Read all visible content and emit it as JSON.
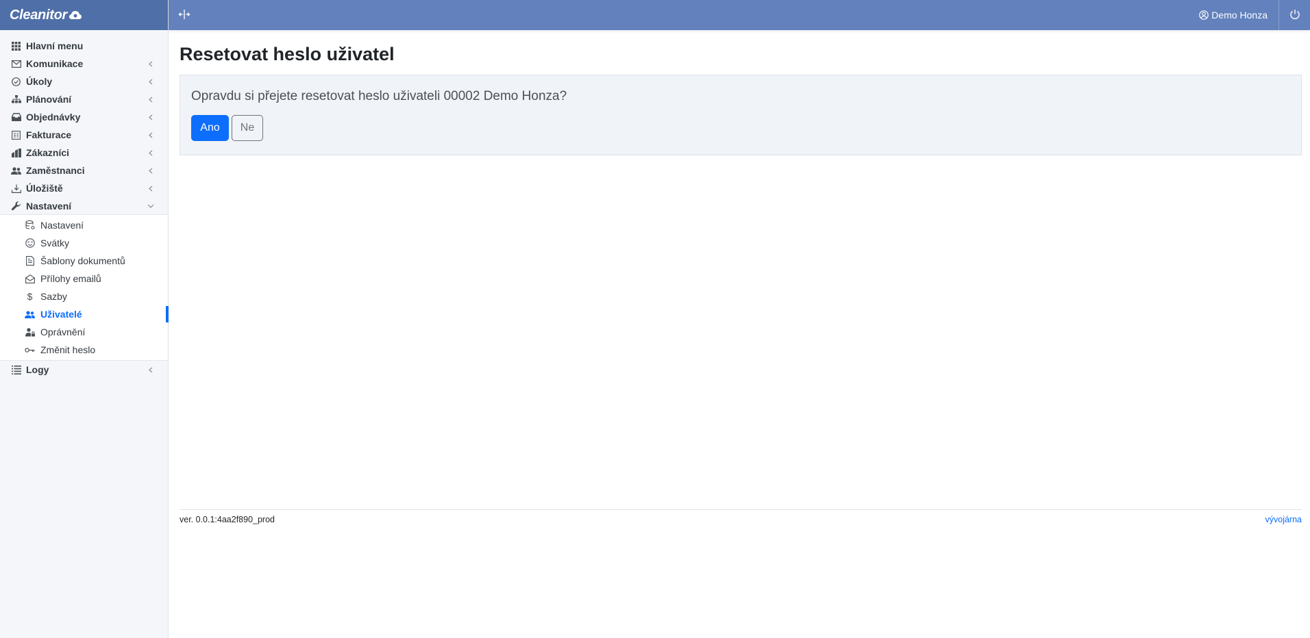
{
  "brand": {
    "name": "Cleanitor"
  },
  "header": {
    "user_name": "Demo Honza"
  },
  "sidebar": {
    "items": [
      {
        "label": "Hlavní menu",
        "icon": "grid-icon",
        "has_submenu": false
      },
      {
        "label": "Komunikace",
        "icon": "envelope-icon",
        "has_submenu": true
      },
      {
        "label": "Úkoly",
        "icon": "check-circle-icon",
        "has_submenu": true
      },
      {
        "label": "Plánování",
        "icon": "sitemap-icon",
        "has_submenu": true
      },
      {
        "label": "Objednávky",
        "icon": "inbox-icon",
        "has_submenu": true
      },
      {
        "label": "Fakturace",
        "icon": "invoice-icon",
        "has_submenu": true
      },
      {
        "label": "Zákazníci",
        "icon": "buildings-icon",
        "has_submenu": true
      },
      {
        "label": "Zaměstnanci",
        "icon": "people-icon",
        "has_submenu": true
      },
      {
        "label": "Úložiště",
        "icon": "download-icon",
        "has_submenu": true
      },
      {
        "label": "Nastavení",
        "icon": "wrench-icon",
        "has_submenu": true,
        "expanded": true
      }
    ],
    "settings_sub": [
      {
        "label": "Nastavení",
        "icon": "database-gear-icon"
      },
      {
        "label": "Svátky",
        "icon": "emoji-icon"
      },
      {
        "label": "Šablony dokumentů",
        "icon": "file-text-icon"
      },
      {
        "label": "Přílohy emailů",
        "icon": "envelope-open-icon"
      },
      {
        "label": "Sazby",
        "icon": "dollar-icon"
      },
      {
        "label": "Uživatelé",
        "icon": "users-icon",
        "active": true
      },
      {
        "label": "Oprávnění",
        "icon": "user-lock-icon"
      },
      {
        "label": "Změnit heslo",
        "icon": "key-icon"
      }
    ],
    "last": {
      "label": "Logy",
      "icon": "list-icon"
    }
  },
  "main": {
    "title": "Resetovat heslo uživatel",
    "question": "Opravdu si přejete resetovat heslo uživateli 00002 Demo Honza?",
    "yes_label": "Ano",
    "no_label": "Ne"
  },
  "footer": {
    "version": "ver. 0.0.1:4aa2f890_prod",
    "link": "vývojárna"
  },
  "colors": {
    "header": "#6281bd",
    "brand_bar": "#4f6fa8",
    "primary": "#0d6efd",
    "sidebar_bg": "#f4f6f9"
  }
}
